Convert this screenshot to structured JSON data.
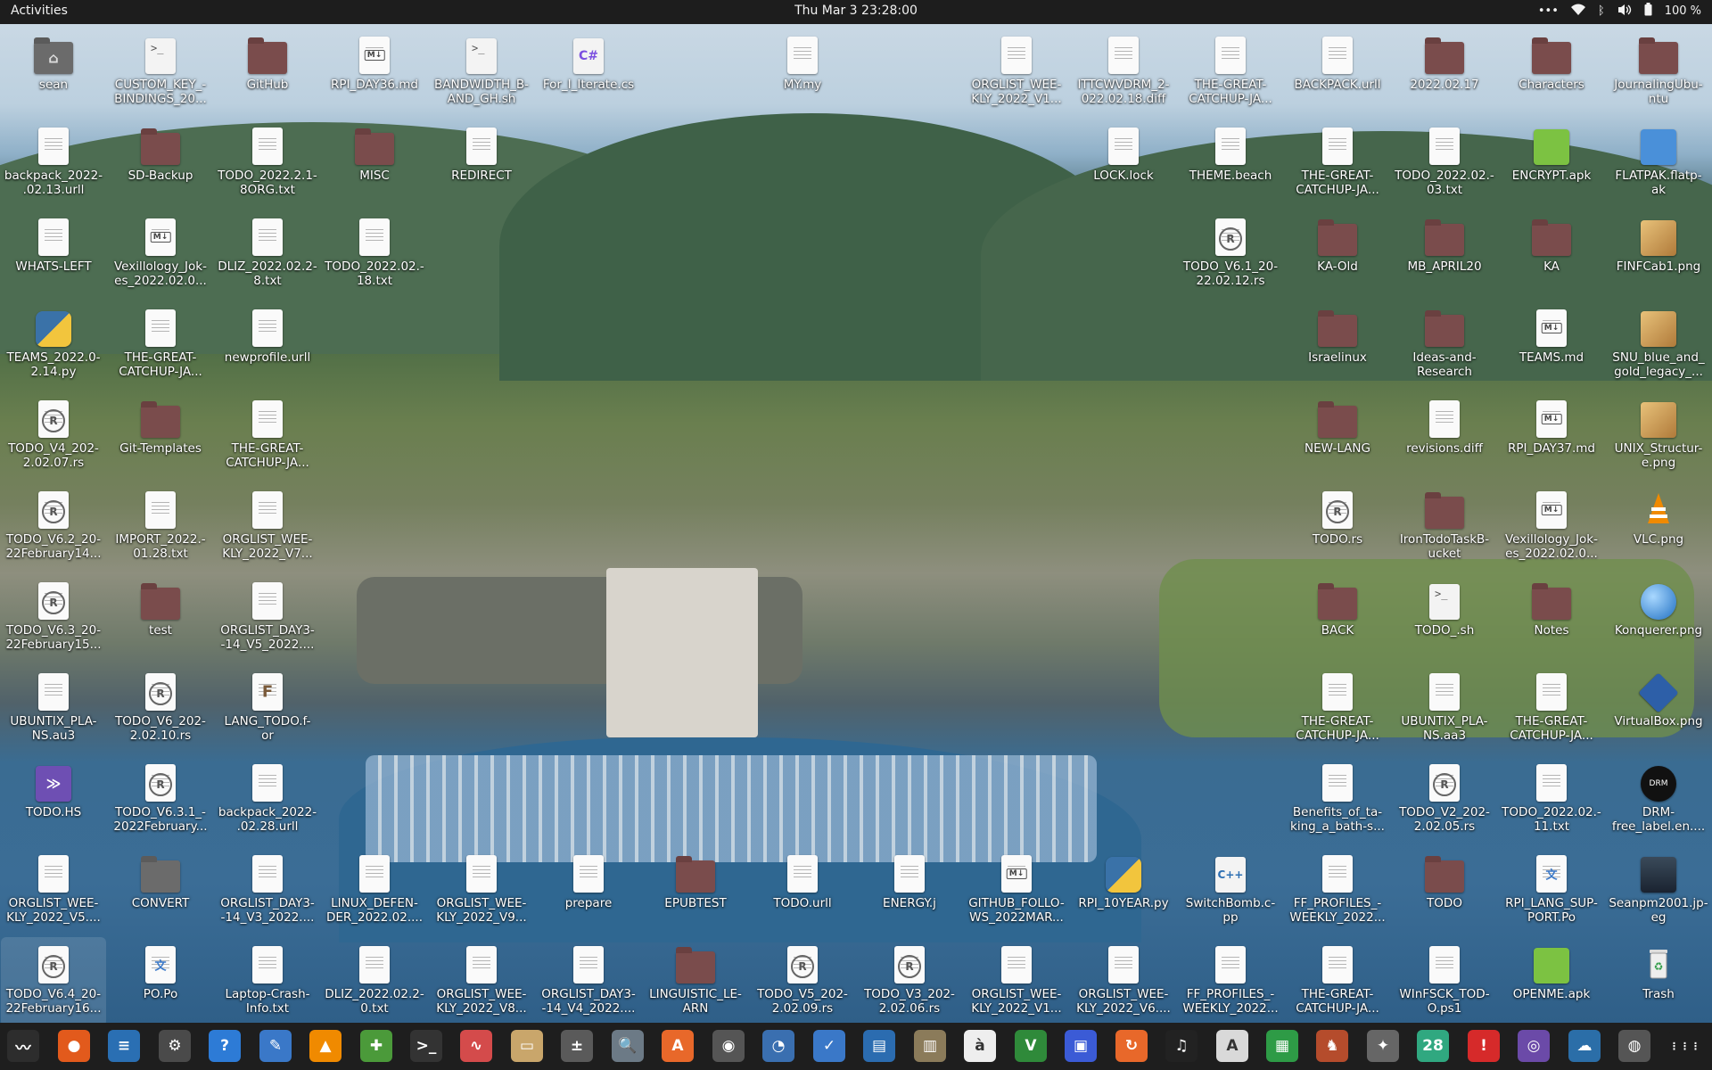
{
  "topbar": {
    "activities": "Activities",
    "clock": "Thu Mar 3  23:28:00",
    "battery": "100 %",
    "tray_icons": [
      "menu-dots-icon",
      "wifi-icon",
      "bluetooth-icon",
      "volume-icon",
      "battery-icon"
    ]
  },
  "desktop": {
    "icons": [
      {
        "label": "sean",
        "type": "home-folder"
      },
      {
        "label": "CUSTOM_KEY_-\nBINDINGS_20...",
        "type": "terminal-script"
      },
      {
        "label": "GitHub",
        "type": "folder"
      },
      {
        "label": "RPI_DAY36.md",
        "type": "markdown"
      },
      {
        "label": "BANDWIDTH_B-\nAND_GH.sh",
        "type": "terminal-script"
      },
      {
        "label": "For_I_Iterate.cs",
        "type": "csharp"
      },
      {
        "label": "MY.my",
        "type": "text"
      },
      {
        "label": "ORGLIST_WEE-\nKLY_2022_V1...",
        "type": "text"
      },
      {
        "label": "ITTCWVDRM_2-\n022.02.18.diff",
        "type": "text"
      },
      {
        "label": "THE-GREAT-\nCATCHUP-JA...",
        "type": "text"
      },
      {
        "label": "BACKPACK.urll",
        "type": "text"
      },
      {
        "label": "2022.02.17",
        "type": "folder"
      },
      {
        "label": "Characters",
        "type": "folder"
      },
      {
        "label": "JournalingUbu-\nntu",
        "type": "folder"
      },
      {
        "label": "backpack_2022-\n.02.13.urll",
        "type": "text"
      },
      {
        "label": "SD-Backup",
        "type": "folder"
      },
      {
        "label": "TODO_2022.2.1-\n8ORG.txt",
        "type": "text"
      },
      {
        "label": "MISC",
        "type": "folder"
      },
      {
        "label": "REDIRECT",
        "type": "text"
      },
      {
        "label": "LOCK.lock",
        "type": "text"
      },
      {
        "label": "THEME.beach",
        "type": "text"
      },
      {
        "label": "THE-GREAT-\nCATCHUP-JA...",
        "type": "text"
      },
      {
        "label": "TODO_2022.02.-\n03.txt",
        "type": "text"
      },
      {
        "label": "ENCRYPT.apk",
        "type": "apk"
      },
      {
        "label": "FLATPAK.flatp-\nak",
        "type": "flatpak"
      },
      {
        "label": "WHATS-LEFT",
        "type": "text"
      },
      {
        "label": "Vexillology_Jok-\nes_2022.02.0...",
        "type": "markdown"
      },
      {
        "label": "DLIZ_2022.02.2-\n8.txt",
        "type": "text"
      },
      {
        "label": "TODO_2022.02.-\n18.txt",
        "type": "text"
      },
      {
        "label": "TODO_V6.1_20-\n22.02.12.rs",
        "type": "rust"
      },
      {
        "label": "KA-Old",
        "type": "folder"
      },
      {
        "label": "MB_APRIL20",
        "type": "folder"
      },
      {
        "label": "KA",
        "type": "folder"
      },
      {
        "label": "FINFCab1.png",
        "type": "image"
      },
      {
        "label": "TEAMS_2022.0-\n2.14.py",
        "type": "python"
      },
      {
        "label": "THE-GREAT-\nCATCHUP-JA...",
        "type": "text"
      },
      {
        "label": "newprofile.urll",
        "type": "text"
      },
      {
        "label": "Israelinux",
        "type": "folder"
      },
      {
        "label": "Ideas-and-\nResearch",
        "type": "folder"
      },
      {
        "label": "TEAMS.md",
        "type": "markdown"
      },
      {
        "label": "SNU_blue_and_\ngold_legacy_...",
        "type": "image"
      },
      {
        "label": "TODO_V4_202-\n2.02.07.rs",
        "type": "rust"
      },
      {
        "label": "Git-Templates",
        "type": "folder"
      },
      {
        "label": "THE-GREAT-\nCATCHUP-JA...",
        "type": "text"
      },
      {
        "label": "NEW-LANG",
        "type": "folder"
      },
      {
        "label": "revisions.diff",
        "type": "text"
      },
      {
        "label": "RPI_DAY37.md",
        "type": "markdown"
      },
      {
        "label": "UNIX_Structur-\ne.png",
        "type": "image"
      },
      {
        "label": "TODO_V6.2_20-\n22February14...",
        "type": "rust"
      },
      {
        "label": "IMPORT_2022.-\n01.28.txt",
        "type": "text"
      },
      {
        "label": "ORGLIST_WEE-\nKLY_2022_V7...",
        "type": "text"
      },
      {
        "label": "TODO.rs",
        "type": "rust"
      },
      {
        "label": "IronTodoTaskB-\nucket",
        "type": "folder"
      },
      {
        "label": "Vexillology_Jok-\nes_2022.02.0...",
        "type": "markdown"
      },
      {
        "label": "VLC.png",
        "type": "vlc"
      },
      {
        "label": "TODO_V6.3_20-\n22February15...",
        "type": "rust"
      },
      {
        "label": "test",
        "type": "folder"
      },
      {
        "label": "ORGLIST_DAY3-\n-14_V5_2022....",
        "type": "text"
      },
      {
        "label": "BACK",
        "type": "folder"
      },
      {
        "label": "TODO_.sh",
        "type": "terminal-script"
      },
      {
        "label": "Notes",
        "type": "folder"
      },
      {
        "label": "Konquerer.png",
        "type": "globe"
      },
      {
        "label": "UBUNTIX_PLA-\nNS.au3",
        "type": "text"
      },
      {
        "label": "TODO_V6_202-\n2.02.10.rs",
        "type": "rust"
      },
      {
        "label": "LANG_TODO.f-\nor",
        "type": "fortran"
      },
      {
        "label": "THE-GREAT-\nCATCHUP-JA...",
        "type": "text"
      },
      {
        "label": "UBUNTIX_PLA-\nNS.aa3",
        "type": "text"
      },
      {
        "label": "THE-GREAT-\nCATCHUP-JA...",
        "type": "text"
      },
      {
        "label": "VirtualBox.png",
        "type": "virtualbox"
      },
      {
        "label": "TODO.HS",
        "type": "haskell"
      },
      {
        "label": "TODO_V6.3.1_-\n2022February...",
        "type": "rust"
      },
      {
        "label": "backpack_2022-\n.02.28.urll",
        "type": "text"
      },
      {
        "label": "Benefits_of_ta-\nking_a_bath-s...",
        "type": "text"
      },
      {
        "label": "TODO_V2_202-\n2.02.05.rs",
        "type": "rust"
      },
      {
        "label": "TODO_2022.02.-\n11.txt",
        "type": "text"
      },
      {
        "label": "DRM-\nfree_label.en....",
        "type": "drm"
      },
      {
        "label": "ORGLIST_WEE-\nKLY_2022_V5....",
        "type": "text"
      },
      {
        "label": "CONVERT",
        "type": "folder-grey"
      },
      {
        "label": "ORGLIST_DAY3-\n-14_V3_2022....",
        "type": "text"
      },
      {
        "label": "LINUX_DEFEN-\nDER_2022.02....",
        "type": "text"
      },
      {
        "label": "ORGLIST_WEE-\nKLY_2022_V9...",
        "type": "text"
      },
      {
        "label": "prepare",
        "type": "text"
      },
      {
        "label": "EPUBTEST",
        "type": "folder"
      },
      {
        "label": "TODO.urll",
        "type": "text"
      },
      {
        "label": "ENERGY.j",
        "type": "text"
      },
      {
        "label": "GITHUB_FOLLO-\nWS_2022MAR...",
        "type": "markdown"
      },
      {
        "label": "RPI_10YEAR.py",
        "type": "python"
      },
      {
        "label": "SwitchBomb.c-\npp",
        "type": "cpp"
      },
      {
        "label": "FF_PROFILES_-\nWEEKLY_2022...",
        "type": "text"
      },
      {
        "label": "TODO",
        "type": "folder"
      },
      {
        "label": "RPI_LANG_SUP-\nPORT.Po",
        "type": "po"
      },
      {
        "label": "Seanpm2001.jp-\neg",
        "type": "photo"
      },
      {
        "label": "TODO_V6.4_20-\n22February16...",
        "type": "rust"
      },
      {
        "label": "PO.Po",
        "type": "po"
      },
      {
        "label": "Laptop-Crash-\nInfo.txt",
        "type": "text"
      },
      {
        "label": "DLIZ_2022.02.2-\n0.txt",
        "type": "text"
      },
      {
        "label": "ORGLIST_WEE-\nKLY_2022_V8...",
        "type": "text"
      },
      {
        "label": "ORGLIST_DAY3-\n-14_V4_2022....",
        "type": "text"
      },
      {
        "label": "LINGUISTIC_LE-\nARN",
        "type": "folder"
      },
      {
        "label": "TODO_V5_202-\n2.02.09.rs",
        "type": "rust"
      },
      {
        "label": "TODO_V3_202-\n2.02.06.rs",
        "type": "rust"
      },
      {
        "label": "ORGLIST_WEE-\nKLY_2022_V1...",
        "type": "text"
      },
      {
        "label": "ORGLIST_WEE-\nKLY_2022_V6....",
        "type": "text"
      },
      {
        "label": "FF_PROFILES_-\nWEEKLY_2022...",
        "type": "text"
      },
      {
        "label": "THE-GREAT-\nCATCHUP-JA...",
        "type": "text"
      },
      {
        "label": "WInFSCK_TOD-\nO.ps1",
        "type": "text"
      },
      {
        "label": "OPENME.apk",
        "type": "apk"
      },
      {
        "label": "Trash",
        "type": "trash"
      }
    ]
  },
  "dock": {
    "items": [
      {
        "name": "system-monitor-icon",
        "glyph": "〰",
        "color": "#2d2d2d"
      },
      {
        "name": "firefox-icon",
        "glyph": "●",
        "color": "#e25a1c"
      },
      {
        "name": "libreoffice-writer-icon",
        "glyph": "≡",
        "color": "#2a6fb3"
      },
      {
        "name": "settings-icon",
        "glyph": "⚙",
        "color": "#4a4a4a"
      },
      {
        "name": "help-icon",
        "glyph": "?",
        "color": "#2d7bd6"
      },
      {
        "name": "text-editor-icon",
        "glyph": "✎",
        "color": "#3a78c8"
      },
      {
        "name": "vlc-icon",
        "glyph": "▲",
        "color": "#f08a00"
      },
      {
        "name": "gnome-extensions-icon",
        "glyph": "✚",
        "color": "#4b9a3a"
      },
      {
        "name": "terminal-icon",
        "glyph": ">_",
        "color": "#333333"
      },
      {
        "name": "waveform-icon",
        "glyph": "∿",
        "color": "#d44b4b"
      },
      {
        "name": "files-icon",
        "glyph": "▭",
        "color": "#c9a66b"
      },
      {
        "name": "calculator-icon",
        "glyph": "±",
        "color": "#5a5a5a"
      },
      {
        "name": "image-viewer-icon",
        "glyph": "🔍",
        "color": "#6c7a86"
      },
      {
        "name": "software-center-icon",
        "glyph": "A",
        "color": "#e8682a"
      },
      {
        "name": "disc-icon",
        "glyph": "◉",
        "color": "#555555"
      },
      {
        "name": "disk-usage-icon",
        "glyph": "◔",
        "color": "#3a6fb0"
      },
      {
        "name": "tasks-icon",
        "glyph": "✓",
        "color": "#3a78c8"
      },
      {
        "name": "scanner-icon",
        "glyph": "▤",
        "color": "#2b6cb0"
      },
      {
        "name": "archive-icon",
        "glyph": "▥",
        "color": "#8b7b5a"
      },
      {
        "name": "character-map-icon",
        "glyph": "à",
        "color": "#eeeeee"
      },
      {
        "name": "vim-icon",
        "glyph": "V",
        "color": "#2f8a3a"
      },
      {
        "name": "screenshot-icon",
        "glyph": "▣",
        "color": "#3b5bd6"
      },
      {
        "name": "backup-icon",
        "glyph": "↻",
        "color": "#e8682a"
      },
      {
        "name": "music-icon",
        "glyph": "♫",
        "color": "#222222"
      },
      {
        "name": "document-viewer-icon",
        "glyph": "A",
        "color": "#d9d9d9"
      },
      {
        "name": "spreadsheet-icon",
        "glyph": "▦",
        "color": "#2e9b46"
      },
      {
        "name": "game-icon",
        "glyph": "♞",
        "color": "#b54c2c"
      },
      {
        "name": "pinta-icon",
        "glyph": "✦",
        "color": "#666666"
      },
      {
        "name": "calendar-icon",
        "glyph": "28",
        "color": "#30a880"
      },
      {
        "name": "alert-icon",
        "glyph": "!",
        "color": "#d62a2a"
      },
      {
        "name": "camera-icon",
        "glyph": "◎",
        "color": "#6b4aa8"
      },
      {
        "name": "weather-icon",
        "glyph": "☁",
        "color": "#2b6ea8"
      },
      {
        "name": "cd-burner-icon",
        "glyph": "◍",
        "color": "#555555"
      },
      {
        "name": "show-apps-icon",
        "glyph": "⋮⋮⋮",
        "color": "#1e1e1e"
      }
    ]
  },
  "colors": {
    "topbar": "#1d1d1d",
    "dock": "#1e1e1e",
    "folder": "#7a4c4c"
  }
}
